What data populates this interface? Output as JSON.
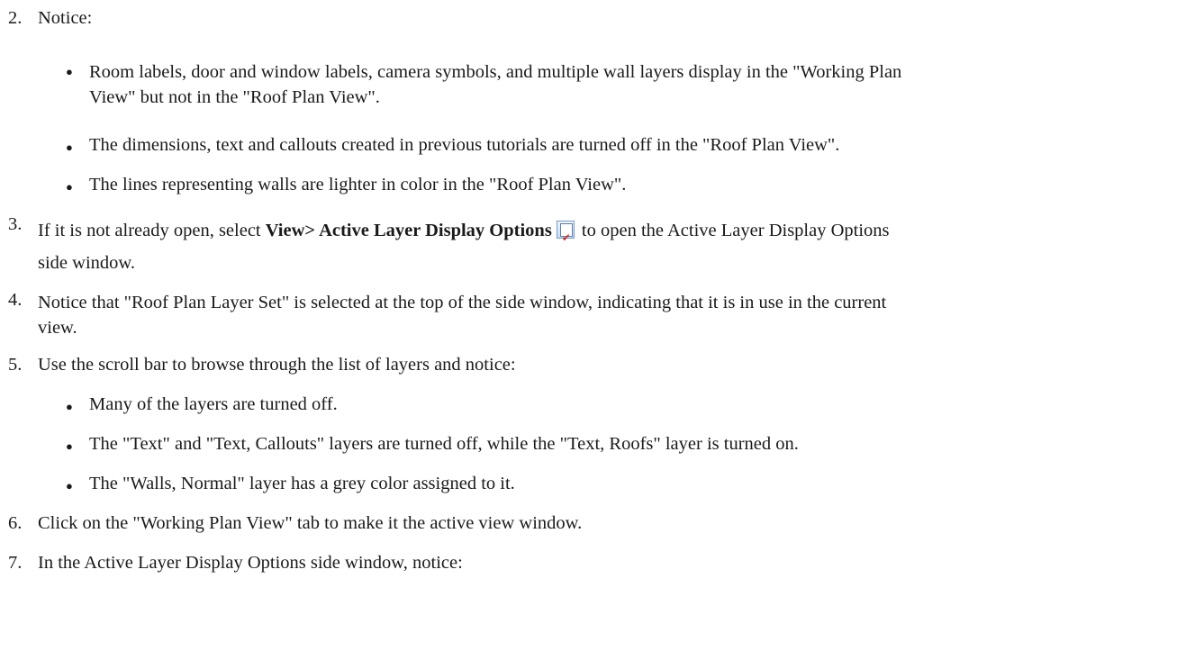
{
  "steps": [
    {
      "num": "2.",
      "text": "Notice:"
    },
    {
      "num": "3.",
      "pre": "If it is not already open, select ",
      "bold": "View> Active Layer Display Options",
      "post_line1": " to open the Active Layer Display Options",
      "post_line2": "side window.",
      "icon": "active-layer-display-options-icon"
    },
    {
      "num": "4.",
      "line1": "Notice that \"Roof Plan Layer Set\" is selected at the top of the side window, indicating that it is in use in the current",
      "line2": "view."
    },
    {
      "num": "5.",
      "text": "Use the scroll bar to browse through the list of layers and notice:"
    },
    {
      "num": "6.",
      "text": "Click on the \"Working Plan View\" tab to make it the active view window."
    },
    {
      "num": "7.",
      "text": "In the Active Layer Display Options side window, notice:"
    }
  ],
  "step2_bullets": [
    {
      "line1": "Room labels, door and window labels, camera symbols, and multiple wall layers display in the \"Working Plan",
      "line2": "View\" but not in the \"Roof Plan View\"."
    },
    {
      "text": "The dimensions, text and callouts created in previous tutorials are turned off in the \"Roof Plan View\"."
    },
    {
      "text": "The lines representing walls are lighter in color in the \"Roof Plan View\"."
    }
  ],
  "step5_bullets": [
    {
      "text": "Many of the layers are turned off."
    },
    {
      "text": "The \"Text\" and \"Text, Callouts\" layers are turned off, while the \"Text, Roofs\" layer is turned on."
    },
    {
      "text": "The \"Walls, Normal\" layer has a grey color assigned to it."
    }
  ],
  "bullet_glyph": "●"
}
